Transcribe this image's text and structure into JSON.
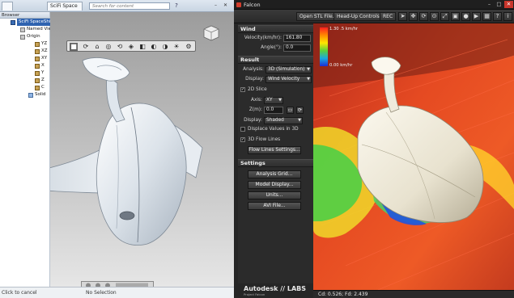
{
  "left_window": {
    "tabs": {
      "file_label": "",
      "doc_label": "SciFi Space"
    },
    "search": {
      "placeholder": "Search for content"
    },
    "window_buttons": {
      "minimize": "–",
      "close": "✕"
    },
    "browser": {
      "title": "Browser",
      "items": [
        {
          "label": "SciFi SpaceShip - Bi",
          "selected": true
        },
        {
          "label": "Named Views",
          "selected": false
        },
        {
          "label": "Origin",
          "selected": false
        },
        {
          "label": "YZ",
          "selected": false
        },
        {
          "label": "XZ",
          "selected": false
        },
        {
          "label": "XY",
          "selected": false
        },
        {
          "label": "X",
          "selected": false
        },
        {
          "label": "Y",
          "selected": false
        },
        {
          "label": "Z",
          "selected": false
        },
        {
          "label": "C",
          "selected": false
        },
        {
          "label": "Solid",
          "selected": false
        }
      ]
    },
    "status": {
      "prompt": "Click to cancel",
      "selection": "No Selection"
    }
  },
  "right_window": {
    "title": "Falcon",
    "toolbar": {
      "open_stl": "Open STL File...",
      "head_up": "Head-Up Controls",
      "rec": "REC"
    },
    "wind": {
      "heading": "Wind",
      "velocity_label": "Velocity(km/hr):",
      "velocity_value": "161.80",
      "angle_label": "Angle(°):",
      "angle_value": "0.0"
    },
    "result": {
      "heading": "Result",
      "analysis_label": "Analysis:",
      "analysis_value": "3D (Simulation)",
      "display_label": "Display:",
      "display_value": "Wind Velocity",
      "slice_label": "2D Slice",
      "slice_checked": true,
      "axis_label": "Axis:",
      "axis_value": "XY",
      "z_label": "Z(m):",
      "z_value": "0.0",
      "display2_label": "Display:",
      "display2_value": "Shaded",
      "displace_label": "Displace Values in 3D",
      "displace_checked": false,
      "flowlines_label": "3D Flow Lines",
      "flowlines_checked": true,
      "flowlines_settings": "Flow Lines Settings..."
    },
    "settings": {
      "heading": "Settings",
      "analysis_grid": "Analysis Grid...",
      "model_display": "Model Display...",
      "units": "Units...",
      "avi_file": "AVI File..."
    },
    "brand": {
      "name": "Autodesk // LABS",
      "subtitle": "Project Falcon"
    },
    "legend": {
      "top": "1.30 .5 km/hr",
      "bottom": "0.00 km/hr"
    },
    "status": {
      "coefficients": "Cd: 0.526; Fd: 2.439"
    }
  },
  "colors": {
    "falcon_bg": "#2b2b2b",
    "accent_red": "#c8352b",
    "browser_select": "#2f63b0"
  }
}
